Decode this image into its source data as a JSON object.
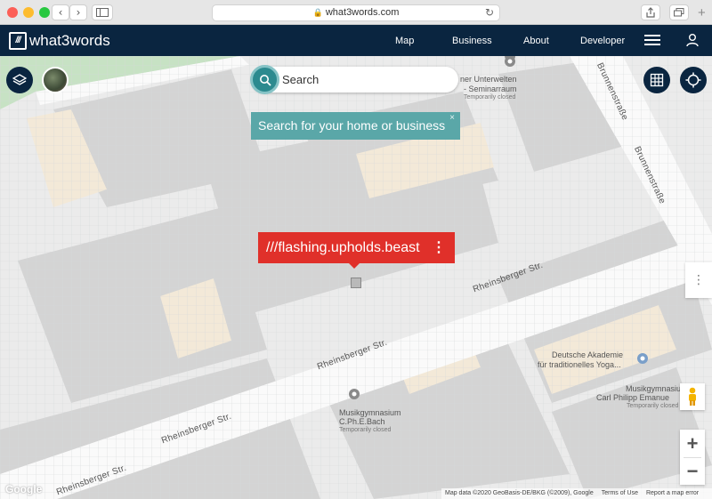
{
  "browser": {
    "url": "what3words.com"
  },
  "header": {
    "logo_mark": "///",
    "logo_text": "what3words",
    "nav": [
      "Map",
      "Business",
      "About",
      "Developer"
    ]
  },
  "search": {
    "placeholder": "Search",
    "hint": "Search for your home or business",
    "hint_close": "×"
  },
  "address": {
    "words": "///flashing.upholds.beast",
    "more": "⋮"
  },
  "map": {
    "streets": {
      "rheinsberger_1": "Rheinsberger Str.",
      "rheinsberger_2": "Rheinsberger Str.",
      "rheinsberger_3": "Rheinsberger Str.",
      "rheinsberger_4": "Rheinsberger Str.",
      "brunnen_1": "Brunnenstraße",
      "brunnen_2": "Brunnenstraße"
    },
    "pois": {
      "unterwelten_1": "ner Unterwelten",
      "unterwelten_2": "- Seminarraum",
      "unterwelten_status": "Temporarily closed",
      "akademie_1": "Deutsche Akademie",
      "akademie_2": "für traditionelles Yoga...",
      "bach_1": "Musikgymnasium",
      "bach_2": "C.Ph.E.Bach",
      "bach_status": "Temporarily closed",
      "carl_1": "Musikgymnasiu",
      "carl_2": "Carl Philipp Emanue",
      "carl_status": "Temporarily closed"
    },
    "google": "Google",
    "attribution": [
      "Map data ©2020 GeoBasis-DE/BKG (©2009), Google",
      "Terms of Use",
      "Report a map error"
    ],
    "zoom_in": "+",
    "zoom_out": "−",
    "side_more": "⋮"
  },
  "colors": {
    "header_bg": "#0a2540",
    "w3w_red": "#e0302a",
    "search_teal": "#2c8a8f",
    "hint_bg": "#5aa7a8"
  }
}
